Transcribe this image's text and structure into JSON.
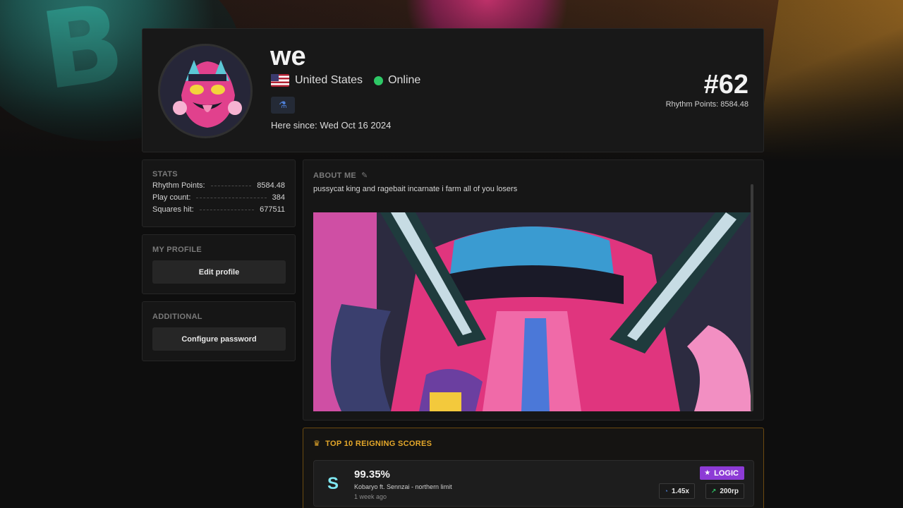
{
  "profile": {
    "username": "we",
    "country": "United States",
    "status": "Online",
    "since": "Here since: Wed Oct 16 2024",
    "rank": "#62",
    "rank_sub": "Rhythm Points: 8584.48"
  },
  "stats": {
    "title": "STATS",
    "rows": [
      {
        "label": "Rhythm Points:",
        "value": "8584.48"
      },
      {
        "label": "Play count:",
        "value": "384"
      },
      {
        "label": "Squares hit:",
        "value": "677511"
      }
    ]
  },
  "my_profile": {
    "title": "MY PROFILE",
    "edit_label": "Edit profile"
  },
  "additional": {
    "title": "ADDITIONAL",
    "password_label": "Configure password"
  },
  "about": {
    "title": "ABOUT ME",
    "text": "pussycat king and ragebait incarnate i farm all of you losers"
  },
  "scores": {
    "title": "TOP 10 REIGNING SCORES",
    "items": [
      {
        "grade": "S",
        "accuracy": "99.35%",
        "song": "Kobaryo ft. Sennzai - northern limit",
        "ago": "1 week ago",
        "difficulty": "LOGIC",
        "speed": "1.45x",
        "rp": "200rp"
      }
    ]
  },
  "colors": {
    "accent_gold": "#e5a82a",
    "online": "#2ec866",
    "logic_purple": "#8d3bd6",
    "grade_cyan": "#7fe6f0"
  }
}
